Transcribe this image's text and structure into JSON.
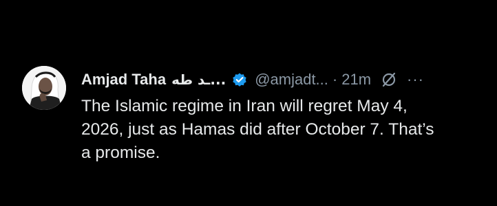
{
  "tweet": {
    "author_name": "Amjad Taha",
    "author_name_arabic": "ـد طه...",
    "handle": "@amjadt...",
    "separator": "·",
    "time": "21m",
    "more": "···",
    "text_lines": [
      "The Islamic regime in Iran will regret May 4,",
      "2026, just as Hamas did after October 7. That’s",
      "a promise."
    ]
  },
  "icons": {
    "verified": "verified-badge-icon",
    "grok": "grok-icon",
    "more": "more-icon"
  },
  "colors": {
    "background": "#000000",
    "text": "#e7e9ea",
    "secondary": "#8b98a5",
    "verified": "#1d9bf0"
  }
}
